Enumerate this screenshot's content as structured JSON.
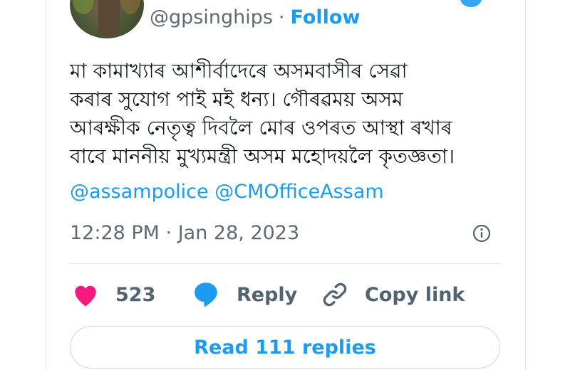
{
  "author": {
    "handle": "@gpsinghips",
    "separator": "·",
    "follow_label": "Follow"
  },
  "tweet": {
    "lines": [
      "মা কামাখ্যাৰ আশীৰ্বাদেৰে অসমবাসীৰ সেৱা",
      "কৰাৰ সুযোগ পাই মই ধন্য।  গৌৰৱময় অসম",
      "আৰক্ষীক নেতৃত্ব দিবলৈ মোৰ ওপৰত আস্থা ৰখাৰ",
      "বাবে মাননীয় মুখ্যমন্ত্ৰী অসম মহোদয়লৈ কৃতজ্ঞতা।"
    ],
    "mentions": [
      "@assampolice",
      "@CMOfficeAssam"
    ],
    "timestamp": "12:28 PM · Jan 28, 2023"
  },
  "actions": {
    "like_count": "523",
    "reply_label": "Reply",
    "copy_link_label": "Copy link"
  },
  "read_replies_label": "Read 111 replies",
  "colors": {
    "accent": "#1d9bf0",
    "heart": "#f91880",
    "text": "#14171a",
    "muted": "#606a72"
  },
  "icons": {
    "like": "heart-icon",
    "reply": "speech-bubble-icon",
    "copy": "link-icon",
    "info": "info-icon"
  }
}
